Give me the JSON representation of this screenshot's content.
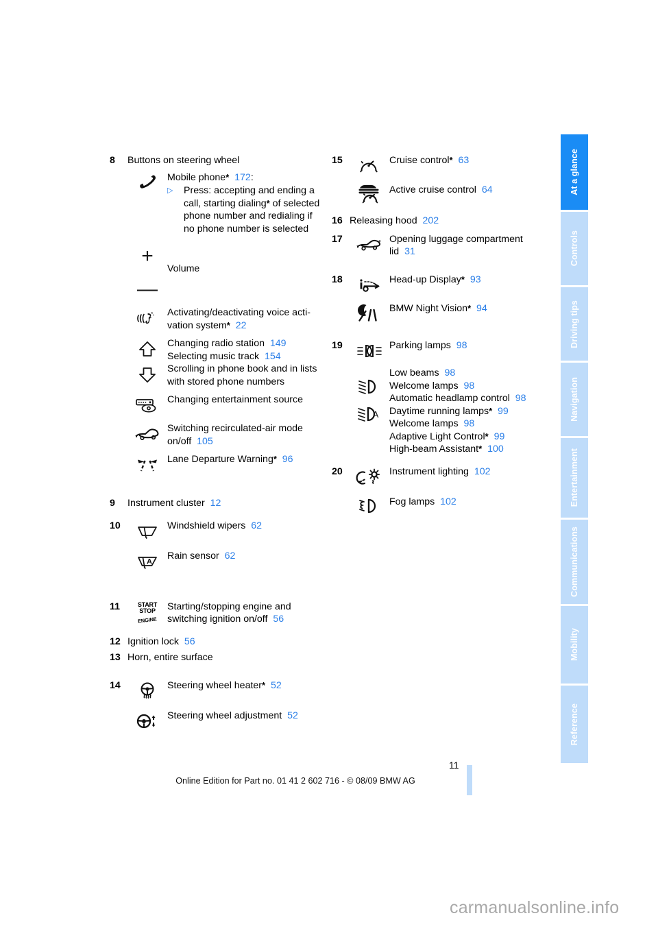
{
  "document": {
    "page_number": "11",
    "footer_text": "Online Edition for Part no. 01 41 2 602 716 - © 08/09 BMW AG",
    "watermark": "carmanualsonline.info"
  },
  "colors": {
    "page_reference": "#2b7fe8",
    "tab_active": "#1a8cf5",
    "tab_inactive": "#bfdcfa"
  },
  "tabs": [
    {
      "label": "At a glance",
      "active": true
    },
    {
      "label": "Controls",
      "active": false
    },
    {
      "label": "Driving tips",
      "active": false
    },
    {
      "label": "Navigation",
      "active": false
    },
    {
      "label": "Entertainment",
      "active": false
    },
    {
      "label": "Communications",
      "active": false
    },
    {
      "label": "Mobility",
      "active": false
    },
    {
      "label": "Reference",
      "active": false
    }
  ],
  "left_column": {
    "item8": {
      "number": "8",
      "title": "Buttons on steering wheel",
      "mobile_phone": {
        "label": "Mobile phone",
        "asterisk": "*",
        "page": "172",
        "colon": ":"
      },
      "press_bullet": "▷",
      "press_text_a": "Press: accepting and ending a call, starting dialing",
      "press_asterisk": "*",
      "press_text_b": " of selected phone number and redialing if no phone number is selected",
      "plus": "+",
      "minus": "—",
      "volume": "Volume",
      "voice_label_a": "Activating/deactivating voice acti-",
      "voice_label_b": "vation system",
      "voice_asterisk": "*",
      "voice_page": "22",
      "radio_label": "Changing radio station",
      "radio_page": "149",
      "music_label": "Selecting music track",
      "music_page": "154",
      "scroll_label_a": "Scrolling in phone book and in lists",
      "scroll_label_b": "with stored phone numbers",
      "entertainment_label": "Changing entertainment source",
      "recirc_label_a": "Switching recirculated-air mode",
      "recirc_label_b": "on/off",
      "recirc_page": "105",
      "ldw_label": "Lane Departure Warning",
      "ldw_asterisk": "*",
      "ldw_page": "96"
    },
    "item9": {
      "number": "9",
      "label": "Instrument cluster",
      "page": "12"
    },
    "item10": {
      "number": "10",
      "wipers_label": "Windshield wipers",
      "wipers_page": "62",
      "rain_label": "Rain sensor",
      "rain_page": "62",
      "rain_icon_letter": "A"
    },
    "item11": {
      "number": "11",
      "icon_line1": "START",
      "icon_line2": "STOP",
      "icon_line3": "ENGINE",
      "label_a": "Starting/stopping engine and",
      "label_b": "switching ignition on/off",
      "page": "56"
    },
    "item12": {
      "number": "12",
      "label": "Ignition lock",
      "page": "56"
    },
    "item13": {
      "number": "13",
      "label": "Horn, entire surface"
    },
    "item14": {
      "number": "14",
      "heater_label": "Steering wheel heater",
      "heater_asterisk": "*",
      "heater_page": "52",
      "adjust_label": "Steering wheel adjustment",
      "adjust_page": "52"
    }
  },
  "right_column": {
    "item15": {
      "number": "15",
      "cruise_label": "Cruise control",
      "cruise_asterisk": "*",
      "cruise_page": "63",
      "acc_label": "Active cruise control",
      "acc_page": "64"
    },
    "item16": {
      "number": "16",
      "label": "Releasing hood",
      "page": "202"
    },
    "item17": {
      "number": "17",
      "label_a": "Opening luggage compartment",
      "label_b": "lid",
      "page": "31"
    },
    "item18": {
      "number": "18",
      "hud_label": "Head-up Display",
      "hud_asterisk": "*",
      "hud_page": "93",
      "night_label": "BMW Night Vision",
      "night_asterisk": "*",
      "night_page": "94"
    },
    "item19": {
      "number": "19",
      "parking_label": "Parking lamps",
      "parking_page": "98",
      "low_beams_label": "Low beams",
      "low_beams_page": "98",
      "welcome1_label": "Welcome lamps",
      "welcome1_page": "98",
      "auto_headlamp_label": "Automatic headlamp control",
      "auto_headlamp_page": "98",
      "drl_label": "Daytime running lamps",
      "drl_asterisk": "*",
      "drl_page": "99",
      "welcome2_label": "Welcome lamps",
      "welcome2_page": "98",
      "alc_label": "Adaptive Light Control",
      "alc_asterisk": "*",
      "alc_page": "99",
      "hba_label": "High-beam Assistant",
      "hba_asterisk": "*",
      "hba_page": "100",
      "auto_icon_letter": "A"
    },
    "item20": {
      "number": "20",
      "instrument_label": "Instrument lighting",
      "instrument_page": "102",
      "fog_label": "Fog lamps",
      "fog_page": "102"
    }
  }
}
